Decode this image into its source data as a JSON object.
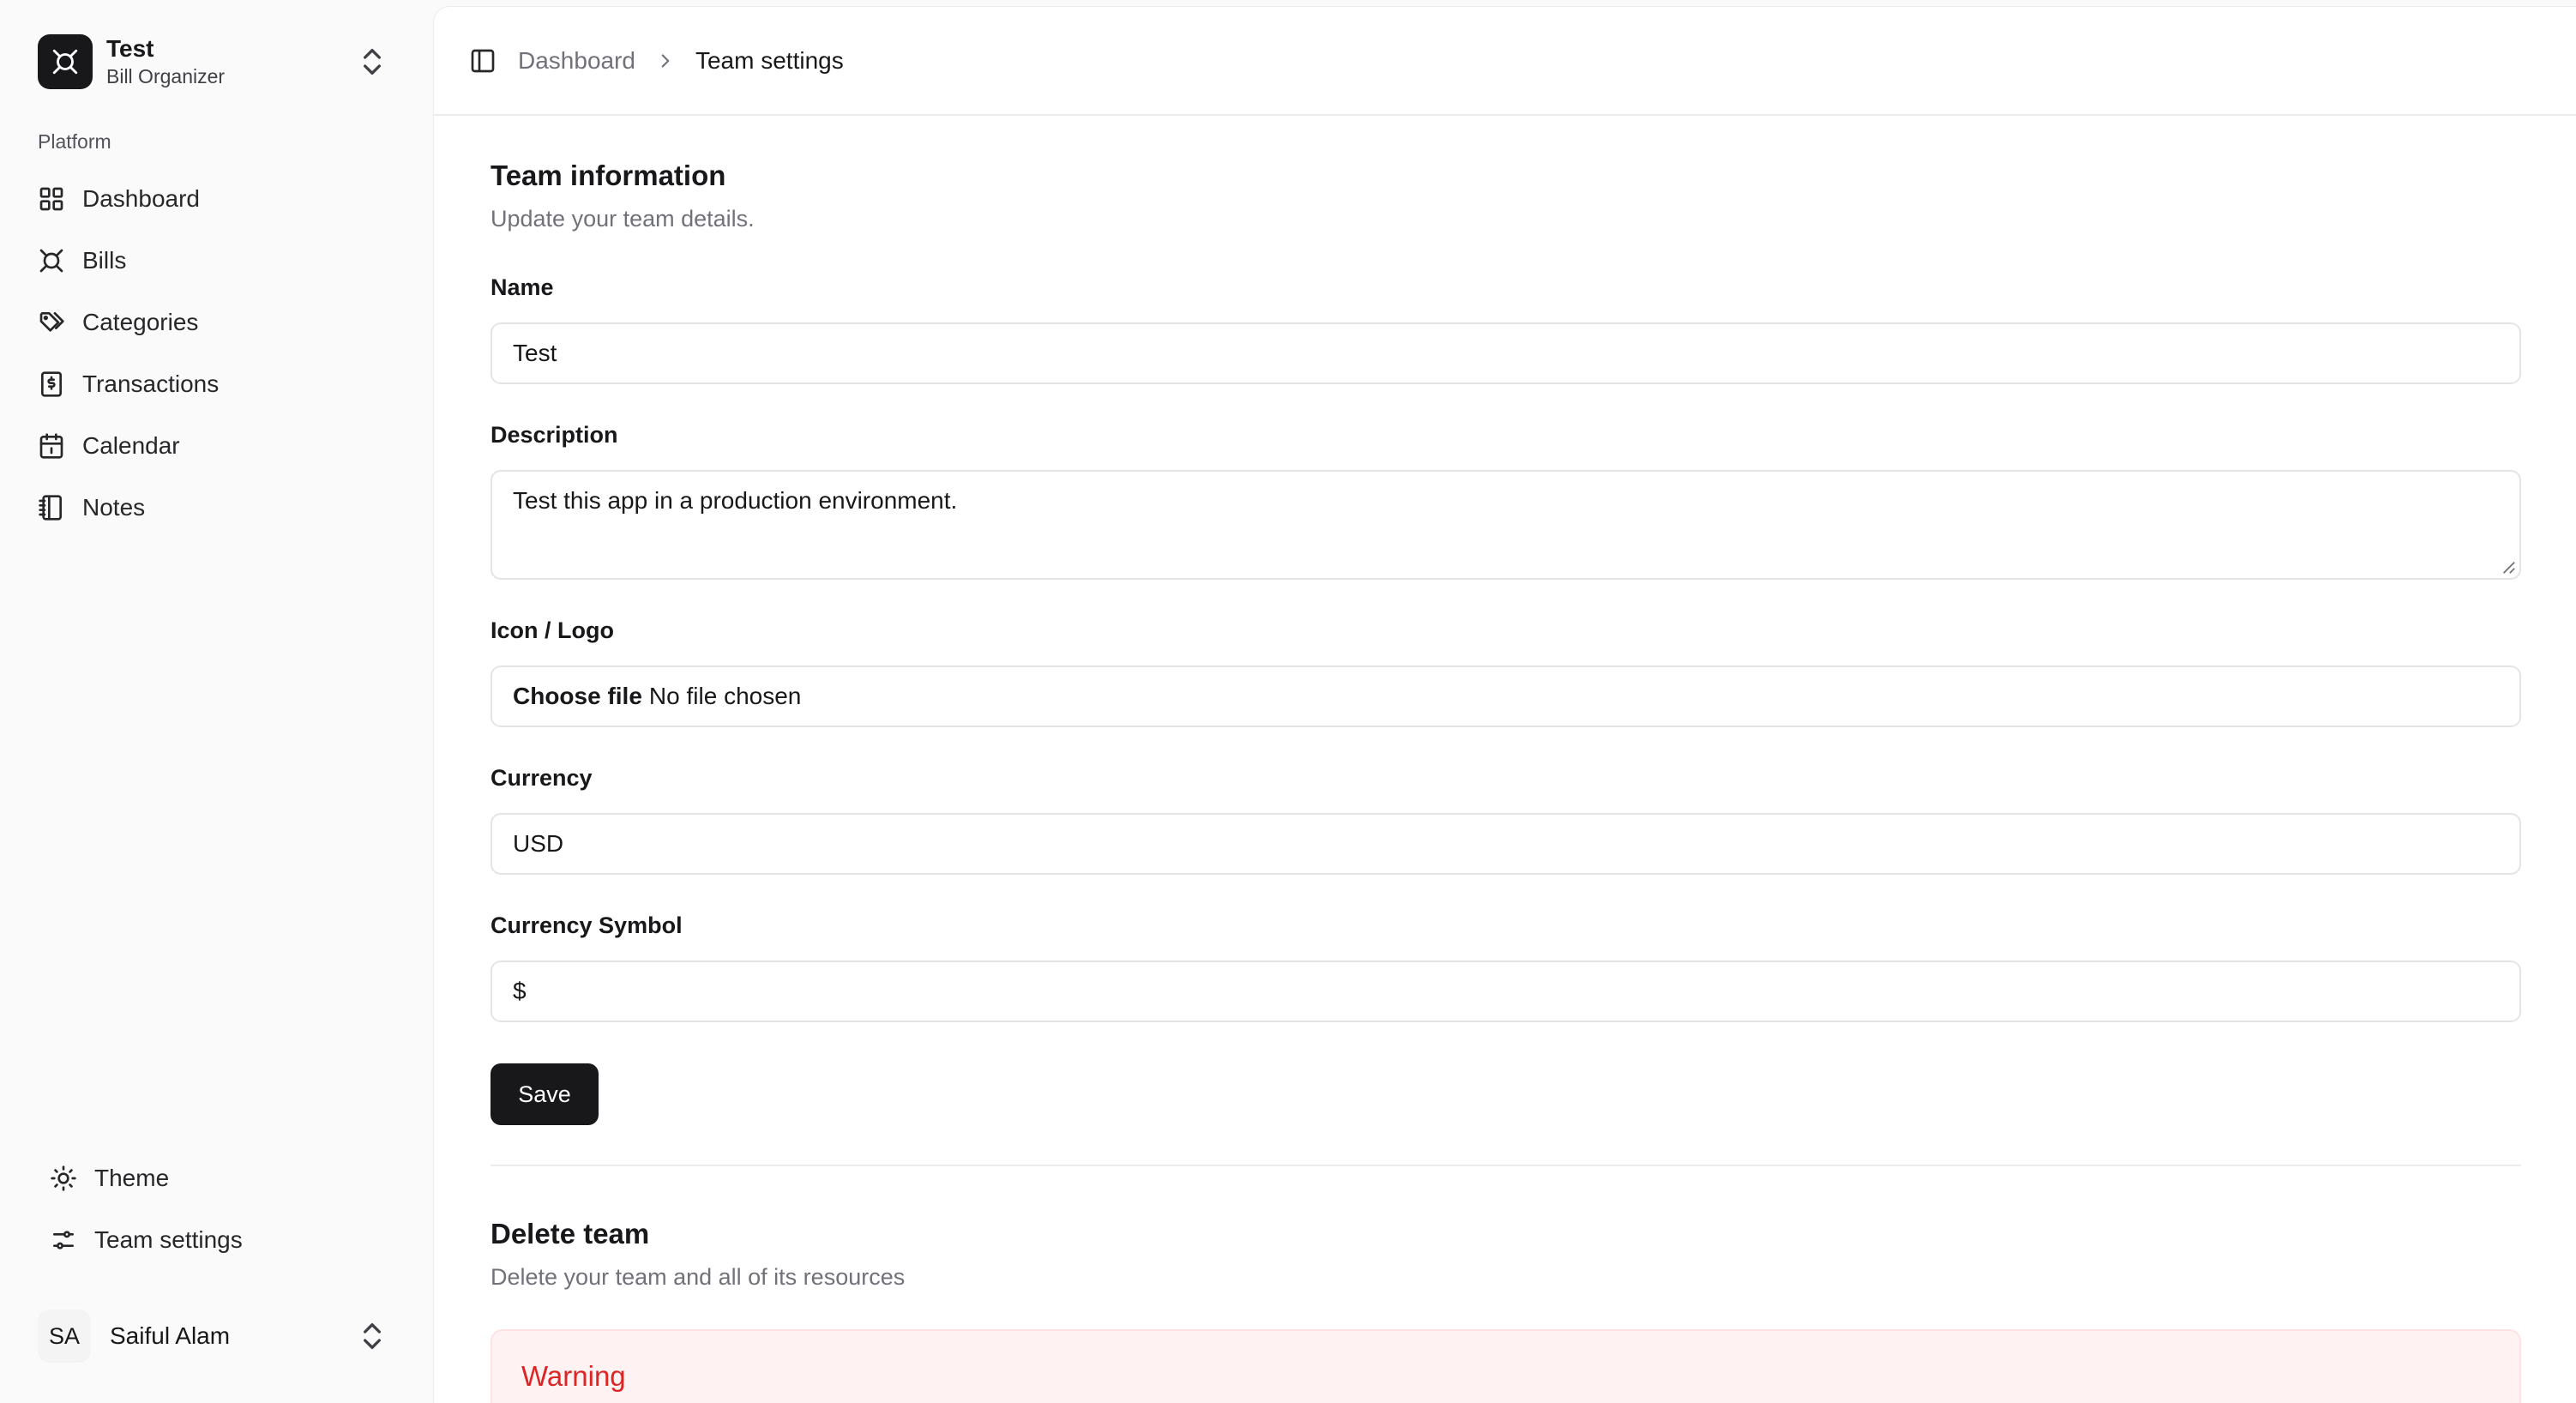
{
  "team": {
    "name": "Test",
    "subtitle": "Bill Organizer"
  },
  "sidebar": {
    "group_label": "Platform",
    "items": [
      {
        "label": "Dashboard",
        "icon": "grid-icon"
      },
      {
        "label": "Bills",
        "icon": "bills-icon"
      },
      {
        "label": "Categories",
        "icon": "tags-icon"
      },
      {
        "label": "Transactions",
        "icon": "receipt-icon"
      },
      {
        "label": "Calendar",
        "icon": "calendar-icon"
      },
      {
        "label": "Notes",
        "icon": "notebook-icon"
      }
    ],
    "bottom_items": [
      {
        "label": "Theme",
        "icon": "sun-icon"
      },
      {
        "label": "Team settings",
        "icon": "sliders-icon"
      }
    ]
  },
  "user": {
    "initials": "SA",
    "name": "Saiful Alam"
  },
  "breadcrumb": {
    "parent": "Dashboard",
    "current": "Team settings"
  },
  "team_info": {
    "title": "Team information",
    "description": "Update your team details.",
    "name_label": "Name",
    "name_value": "Test",
    "description_label": "Description",
    "description_value": "Test this app in a production environment.",
    "logo_label": "Icon / Logo",
    "file_button": "Choose file",
    "file_status": "No file chosen",
    "currency_label": "Currency",
    "currency_value": "USD",
    "symbol_label": "Currency Symbol",
    "symbol_value": "$",
    "save_label": "Save"
  },
  "delete_team": {
    "title": "Delete team",
    "description": "Delete your team and all of its resources",
    "warning_title": "Warning"
  },
  "colors": {
    "accent": "#18181b",
    "danger": "#dc2626",
    "danger_bg": "#fef2f2"
  }
}
